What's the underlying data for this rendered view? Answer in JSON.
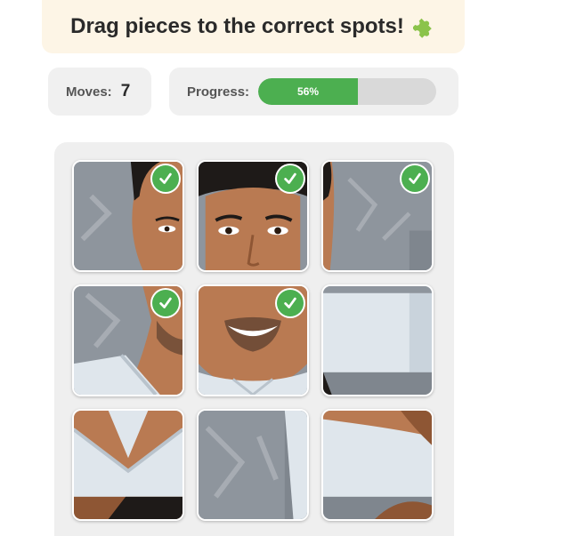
{
  "header": {
    "title": "Drag pieces to the correct spots!",
    "icon": "puzzle-piece-icon"
  },
  "stats": {
    "moves_label": "Moves:",
    "moves_value": "7",
    "progress_label": "Progress:",
    "progress_text": "56%",
    "progress_fraction": 0.56
  },
  "board": {
    "rows": 3,
    "cols": 3,
    "tiles": [
      {
        "piece": "face-left-forehead",
        "correct": true
      },
      {
        "piece": "face-eyes",
        "correct": true
      },
      {
        "piece": "background-right-top",
        "correct": true
      },
      {
        "piece": "cheek-neck-left",
        "correct": true
      },
      {
        "piece": "smile-chin",
        "correct": true
      },
      {
        "piece": "shirt-collar-right",
        "correct": false
      },
      {
        "piece": "shirt-v-neck",
        "correct": false
      },
      {
        "piece": "background-lower-mid",
        "correct": false
      },
      {
        "piece": "shirt-shoulder-right",
        "correct": false
      }
    ]
  },
  "colors": {
    "accent": "#4caf50",
    "banner_bg": "#fdf5e6",
    "panel_bg": "#f0f0f0",
    "track": "#d9d9d9"
  }
}
